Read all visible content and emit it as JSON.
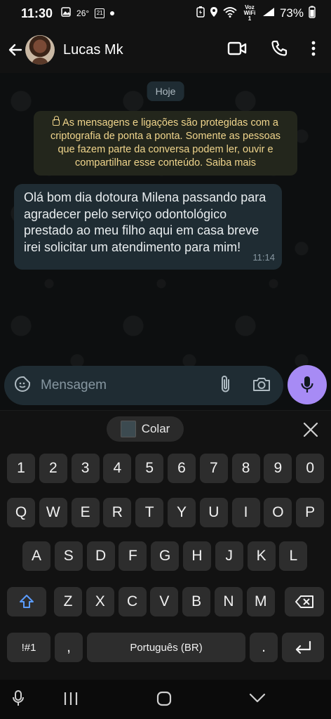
{
  "status_bar": {
    "time": "11:30",
    "temperature": "26°",
    "calendar_day": "21",
    "network": "Voz WiFi 1",
    "battery": "73%"
  },
  "header": {
    "contact_name": "Lucas Mk",
    "icons": [
      "back-arrow-icon",
      "avatar",
      "video-call-icon",
      "phone-icon",
      "more-vert-icon"
    ]
  },
  "chat": {
    "day_chip": "Hoje",
    "encryption_notice": "As mensagens e ligações são protegidas com a criptografia de ponta a ponta. Somente as pessoas que fazem parte da conversa podem ler, ouvir e compartilhar esse conteúdo. Saiba mais",
    "messages": [
      {
        "text": "Olá bom dia dotoura Milena passando para agradecer pelo serviço odontológico prestado ao meu filho aqui em casa breve irei solicitar um atendimento para mim!",
        "time": "11:14",
        "direction": "incoming"
      }
    ]
  },
  "composer": {
    "placeholder": "Mensagem"
  },
  "keyboard": {
    "suggestion": "Colar",
    "row_numbers": [
      "1",
      "2",
      "3",
      "4",
      "5",
      "6",
      "7",
      "8",
      "9",
      "0"
    ],
    "row_1": [
      "Q",
      "W",
      "E",
      "R",
      "T",
      "Y",
      "U",
      "I",
      "O",
      "P"
    ],
    "row_2": [
      "A",
      "S",
      "D",
      "F",
      "G",
      "H",
      "J",
      "K",
      "L"
    ],
    "row_3": [
      "Z",
      "X",
      "C",
      "V",
      "B",
      "N",
      "M"
    ],
    "symbols_key": "!#1",
    "comma_key": ",",
    "space_label": "Português (BR)",
    "period_key": "."
  },
  "colors": {
    "accent_mic": "#a78bf5",
    "bubble": "#1f2c33",
    "notice_text": "#f0d58c"
  }
}
